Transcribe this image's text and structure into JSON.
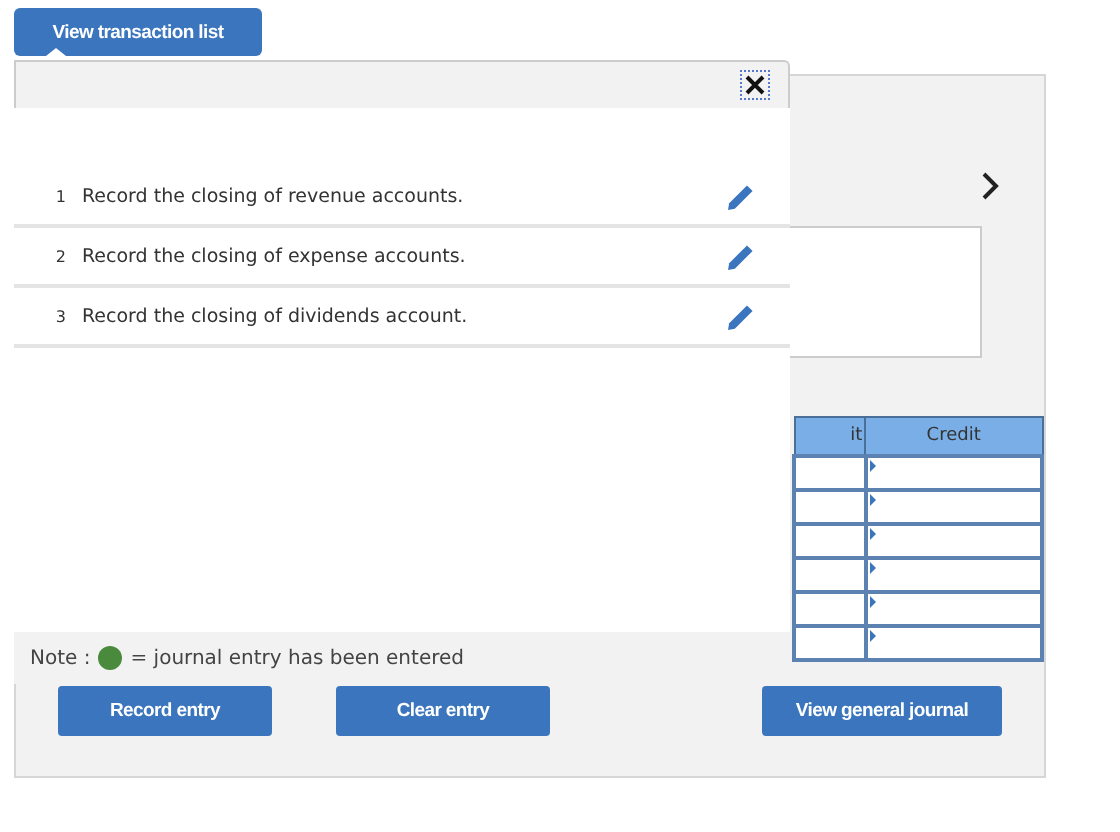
{
  "tab_button": {
    "label": "View transaction list"
  },
  "transaction_popup": {
    "transactions": [
      {
        "number": "1",
        "text": "Record the closing of revenue accounts."
      },
      {
        "number": "2",
        "text": "Record the closing of expense accounts."
      },
      {
        "number": "3",
        "text": "Record the closing of dividends account."
      }
    ],
    "note": {
      "label": "Note :",
      "text": "= journal entry has been entered"
    }
  },
  "journal_table": {
    "columns": [
      "it",
      "Credit"
    ]
  },
  "buttons": [
    "Record entry",
    "Clear entry",
    "View general journal"
  ]
}
